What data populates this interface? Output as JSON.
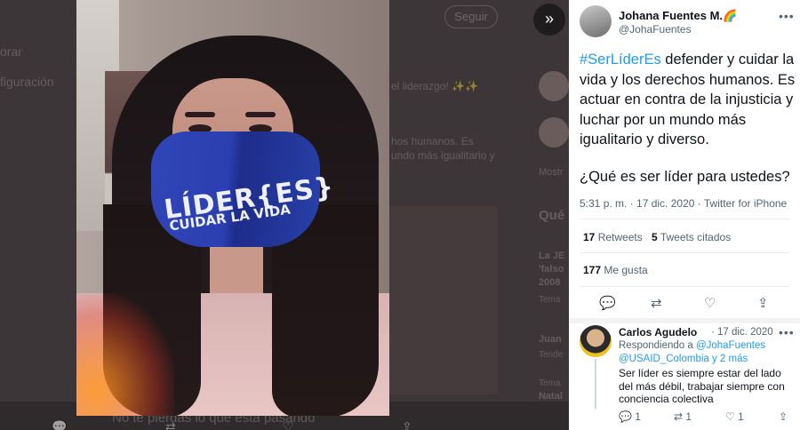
{
  "background": {
    "menu_items": [
      "orar",
      "figuración"
    ],
    "follow_label": "Seguir",
    "snippets": [
      "el liderazgo! ✨✨",
      "hos humanos. Es",
      "undo más igualitario y",
      "Mostr",
      "Qué",
      "La JE",
      "'falso",
      "2008",
      "Tema",
      "Juan",
      "Tende",
      "Tema",
      "Natal"
    ],
    "bottom_caption": "No te pierdas lo que está pasando"
  },
  "nav": {
    "collapse_icon": "chevrons-right-icon"
  },
  "tweet": {
    "author_name": "Johana Fuentes M.",
    "author_emoji": "🌈",
    "author_handle": "@JohaFuentes",
    "hashtag": "#SerLíderEs",
    "body": " defender y cuidar la vida y los derechos humanos. Es actuar en contra de la injusticia y luchar por un mundo más igualitario y diverso.",
    "question": "¿Qué es ser líder para ustedes?",
    "meta": "5:31 p. m. · 17 dic. 2020 · Twitter for iPhone",
    "retweets_count": "17",
    "retweets_label": "Retweets",
    "quotes_count": "5",
    "quotes_label": "Tweets citados",
    "likes_count": "177",
    "likes_label": "Me gusta"
  },
  "photo": {
    "mask_text_line1": "LÍDER{ES}",
    "mask_text_line2": "CUIDAR LA VIDA"
  },
  "reply": {
    "author_name": "Carlos Agudelo",
    "date": "· 17 dic. 2020",
    "replying_prefix": "Respondiendo a",
    "replying_to": "@JohaFuentes",
    "replying_more": "@USAID_Colombia y 2 más",
    "text": "Ser líder es siempre estar del lado del más débil, trabajar siempre con conciencia colectiva",
    "reply_count": "1",
    "retweet_count": "1",
    "like_count": "1"
  },
  "colors": {
    "accent": "#1d9bf0",
    "text": "#0f1419",
    "muted": "#536471"
  }
}
